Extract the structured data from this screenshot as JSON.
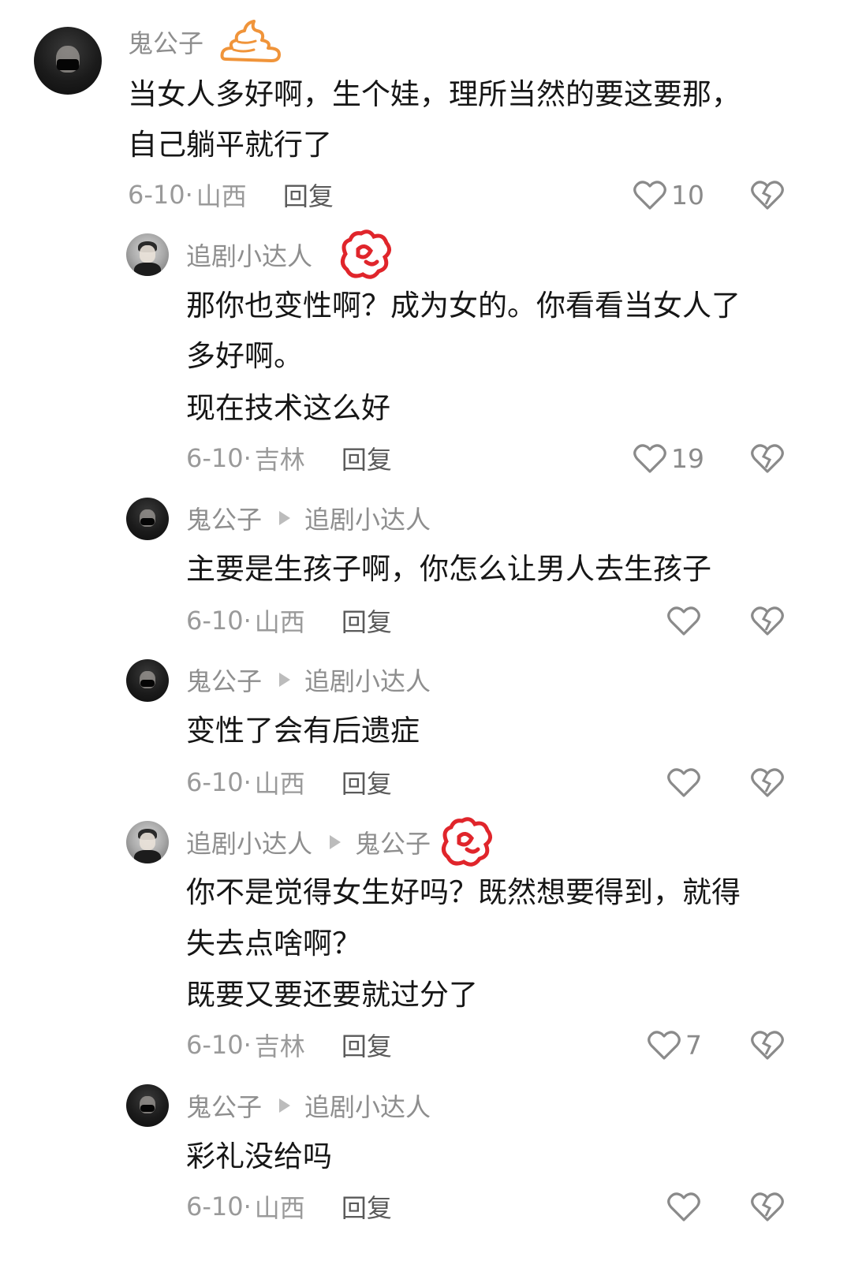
{
  "comments": [
    {
      "author": "鬼公子",
      "reply_to": "",
      "lines": [
        "当女人多好啊，生个娃，理所当然的要这要那，",
        "自己躺平就行了"
      ],
      "date": "6-10·",
      "location": "山西",
      "reply_label": "回复",
      "likes": "10",
      "badge": "poop-sticker"
    },
    {
      "author": "追剧小达人",
      "reply_to": "",
      "lines": [
        "那你也变性啊？成为女的。你看看当女人了",
        "多好啊。",
        "现在技术这么好"
      ],
      "date": "6-10·",
      "location": "吉林",
      "reply_label": "回复",
      "likes": "19",
      "badge": "red-flower-sticker"
    },
    {
      "author": "鬼公子",
      "reply_to": "追剧小达人",
      "lines": [
        "主要是生孩子啊，你怎么让男人去生孩子"
      ],
      "date": "6-10·",
      "location": "山西",
      "reply_label": "回复",
      "likes": ""
    },
    {
      "author": "鬼公子",
      "reply_to": "追剧小达人",
      "lines": [
        "变性了会有后遗症"
      ],
      "date": "6-10·",
      "location": "山西",
      "reply_label": "回复",
      "likes": ""
    },
    {
      "author": "追剧小达人",
      "reply_to": "鬼公子",
      "lines": [
        "你不是觉得女生好吗？既然想要得到，就得",
        "失去点啥啊？",
        "既要又要还要就过分了"
      ],
      "date": "6-10·",
      "location": "吉林",
      "reply_label": "回复",
      "likes": "7",
      "badge": "red-flower-sticker"
    },
    {
      "author": "鬼公子",
      "reply_to": "追剧小达人",
      "lines": [
        "彩礼没给吗"
      ],
      "date": "6-10·",
      "location": "山西",
      "reply_label": "回复",
      "likes": ""
    }
  ],
  "colors": {
    "username": "#8e8e8e",
    "text": "#161616",
    "meta": "#9a9a9a",
    "icon": "#8a8a8a",
    "poop_badge": "#f0943a",
    "flower_badge": "#e0252b"
  },
  "icons": [
    "heart-outline-icon",
    "broken-heart-icon",
    "reply-arrow-icon"
  ]
}
